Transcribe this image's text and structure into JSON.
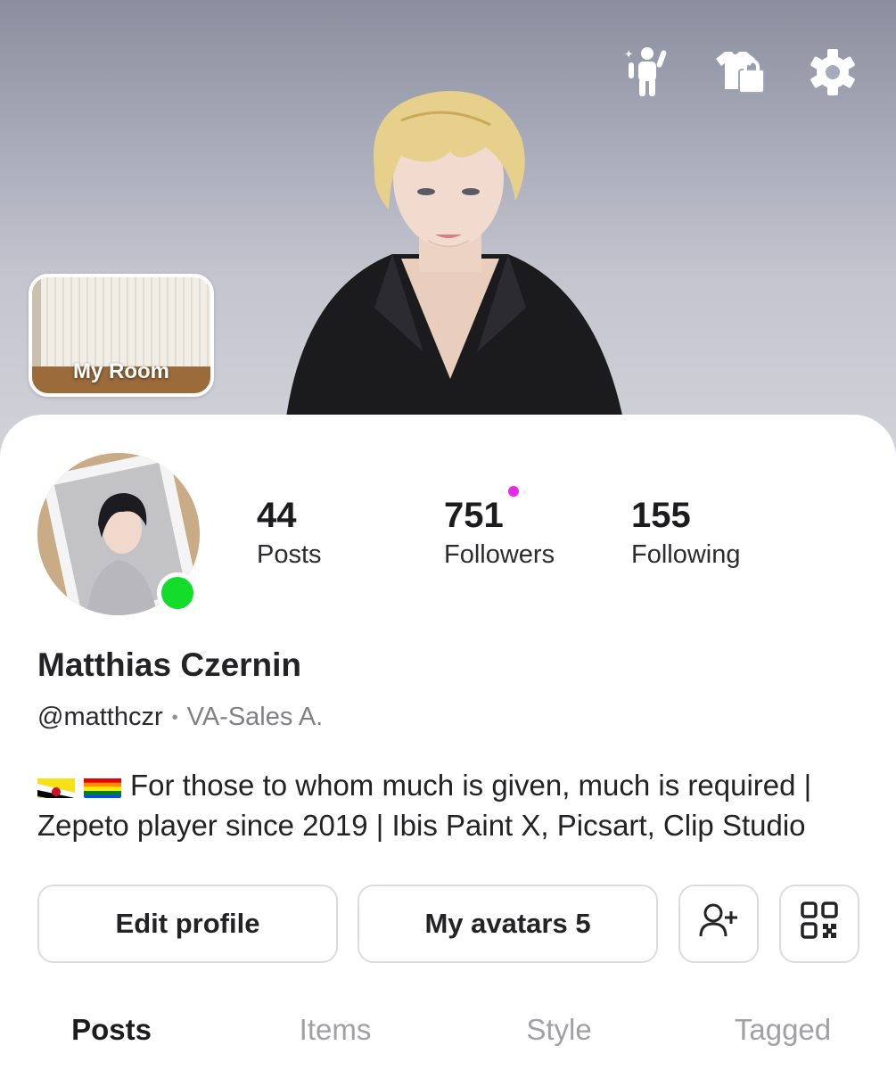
{
  "header": {
    "icons": [
      {
        "name": "avatar-pose-icon"
      },
      {
        "name": "shop-bag-icon"
      },
      {
        "name": "settings-gear-icon"
      }
    ],
    "my_room_label": "My Room"
  },
  "profile": {
    "display_name": "Matthias Czernin",
    "handle": "@matthczr",
    "title": "VA-Sales A.",
    "status": "online",
    "bio_text": "For those to whom much is given, much is required | Zepeto player since 2019 | Ibis Paint X, Picsart, Clip Studio",
    "bio_flags": [
      "brunei-flag-icon",
      "rainbow-pride-flag-icon"
    ]
  },
  "stats": [
    {
      "value": "44",
      "label": "Posts"
    },
    {
      "value": "751",
      "label": "Followers",
      "has_notification": true
    },
    {
      "value": "155",
      "label": "Following"
    }
  ],
  "actions": {
    "edit_profile": "Edit profile",
    "my_avatars": "My avatars 5",
    "add_friend_icon": "add-friend-icon",
    "qr_code_icon": "qr-code-icon"
  },
  "tabs": [
    {
      "label": "Posts",
      "active": true
    },
    {
      "label": "Items",
      "active": false
    },
    {
      "label": "Style",
      "active": false
    },
    {
      "label": "Tagged",
      "active": false
    }
  ],
  "colors": {
    "online": "#14dc2a",
    "notification": "#e52ae9",
    "text_primary": "#1c1c1e",
    "text_muted": "#a0a0a5"
  }
}
